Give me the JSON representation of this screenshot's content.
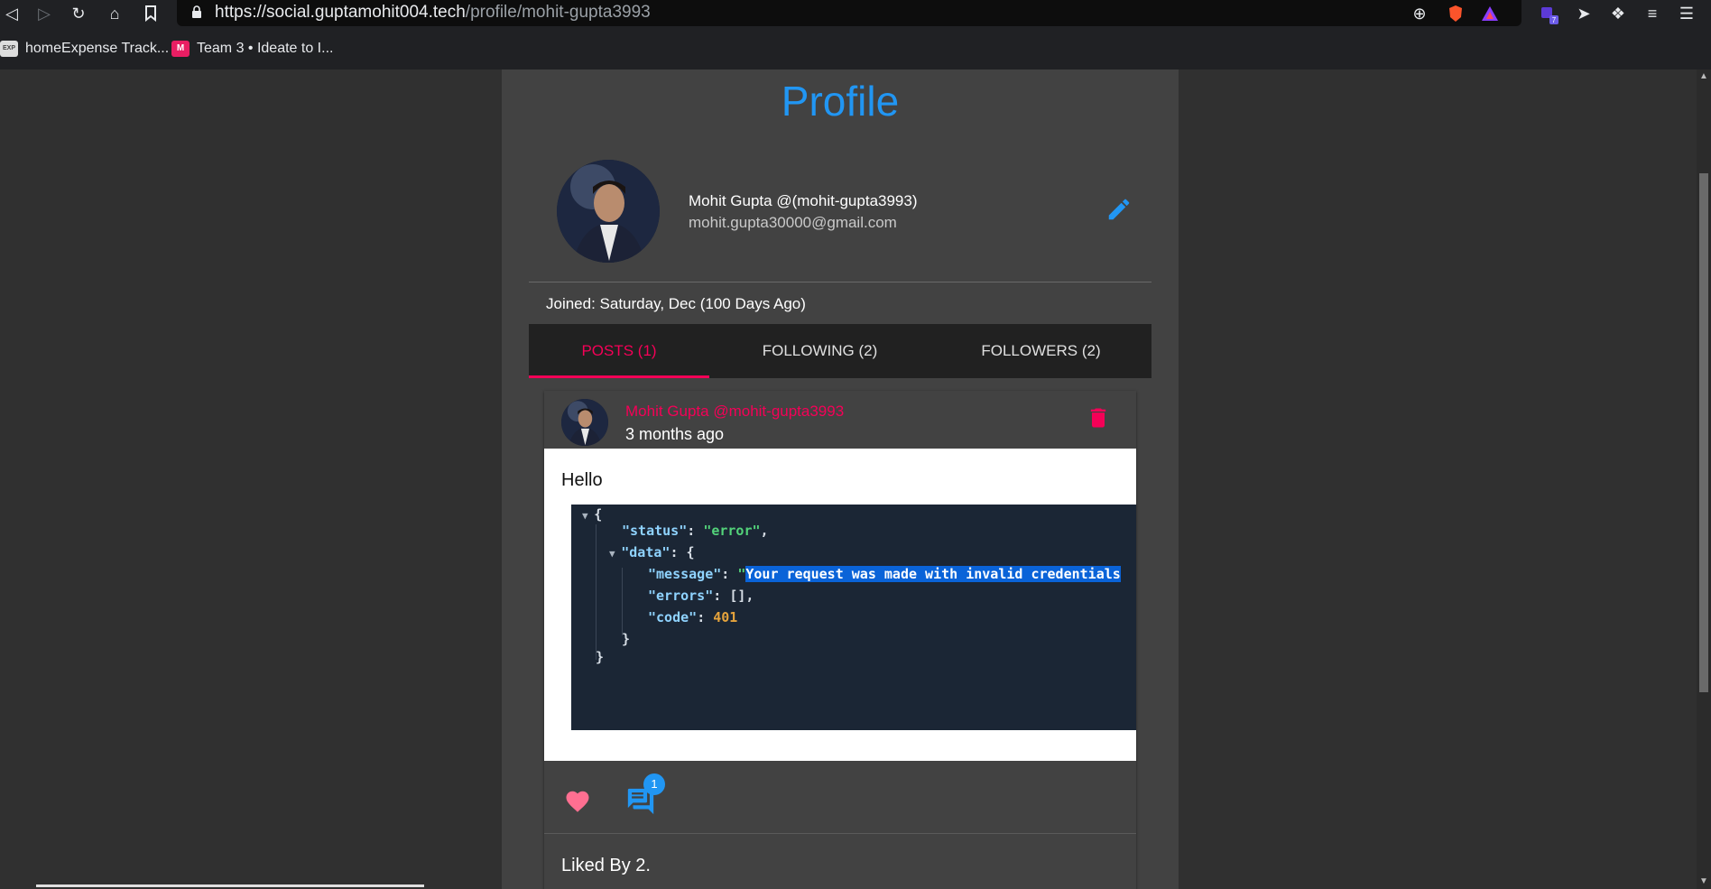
{
  "browser": {
    "url_host": "https://social.guptamohit004.tech",
    "url_path": "/profile/mohit-gupta3993",
    "bookmarks": [
      {
        "label": "homeExpense Track..."
      },
      {
        "label": "Team 3 • Ideate to I..."
      }
    ],
    "extension_badge": "7"
  },
  "profile": {
    "title": "Profile",
    "name_line": "Mohit Gupta @(mohit-gupta3993)",
    "email": "mohit.gupta30000@gmail.com",
    "joined": "Joined: Saturday, Dec (100 Days Ago)"
  },
  "tabs": [
    {
      "label": "POSTS (1)"
    },
    {
      "label": "FOLLOWING (2)"
    },
    {
      "label": "FOLLOWERS (2)"
    }
  ],
  "post": {
    "author": "Mohit Gupta @mohit-gupta3993",
    "time": "3 months ago",
    "text": "Hello",
    "code": {
      "open_brace": "{",
      "status_key": "\"status\"",
      "status_val": "\"error\"",
      "data_key": "\"data\"",
      "message_key": "\"message\"",
      "message_quote": "\"",
      "message_val": "Your request was made with invalid credentials",
      "errors_key": "\"errors\"",
      "errors_val": "[],",
      "code_key": "\"code\"",
      "code_val": "401",
      "inner_close": "}",
      "outer_close": "}"
    },
    "comment_count": "1",
    "liked_by": "Liked By 2."
  },
  "colors": {
    "accent": "#2196f3",
    "secondary": "#f50057",
    "like": "#ff6f91"
  }
}
